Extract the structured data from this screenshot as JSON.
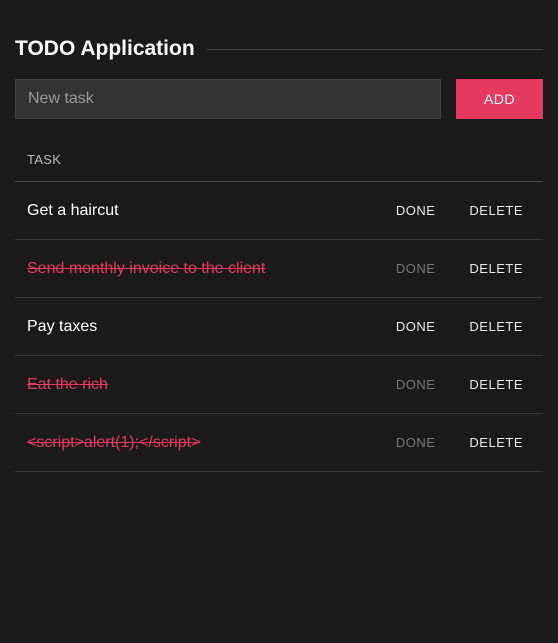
{
  "title": "TODO Application",
  "input": {
    "placeholder": "New task",
    "value": ""
  },
  "buttons": {
    "add": "ADD",
    "done": "DONE",
    "delete": "DELETE"
  },
  "table": {
    "header": "TASK"
  },
  "tasks": [
    {
      "text": "Get a haircut",
      "done": false
    },
    {
      "text": "Send monthly invoice to the client",
      "done": true
    },
    {
      "text": "Pay taxes",
      "done": false
    },
    {
      "text": "Eat the rich",
      "done": true
    },
    {
      "text": "<script>alert(1);</script>",
      "done": true
    }
  ]
}
